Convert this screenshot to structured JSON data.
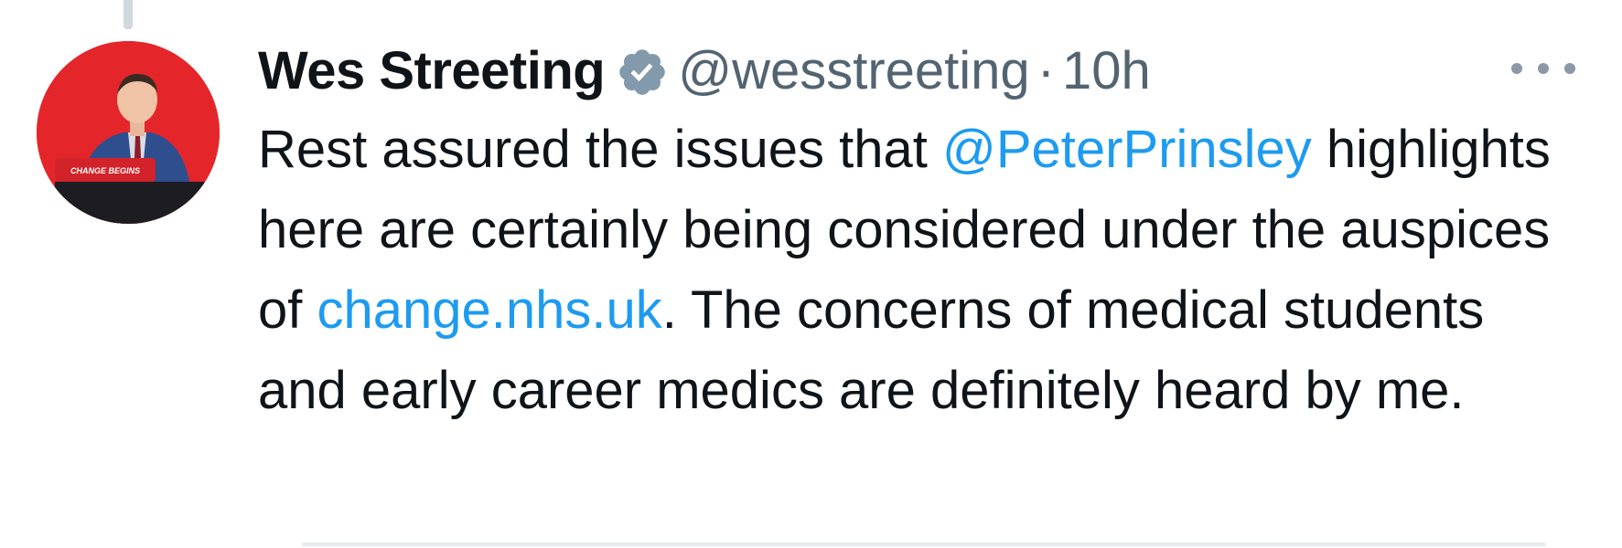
{
  "tweet": {
    "author_name": "Wes Streeting",
    "handle": "@wesstreeting",
    "separator": "·",
    "time": "10h",
    "avatar_label": "CHANGE BEGINS",
    "text_part1": "Rest assured the issues that ",
    "mention": "@PeterPrinsley",
    "text_part2": " highlights here are certainly being considered under the auspices of ",
    "link": "change.nhs.uk",
    "text_part3": ". The concerns of medical students and early career medics are definitely heard by me."
  },
  "icons": {
    "verified": "verified-badge-icon",
    "more": "more-options-icon"
  },
  "colors": {
    "link": "#1d9bf0",
    "muted": "#536471",
    "text": "#0f1419",
    "avatar_bg": "#e4262b"
  }
}
